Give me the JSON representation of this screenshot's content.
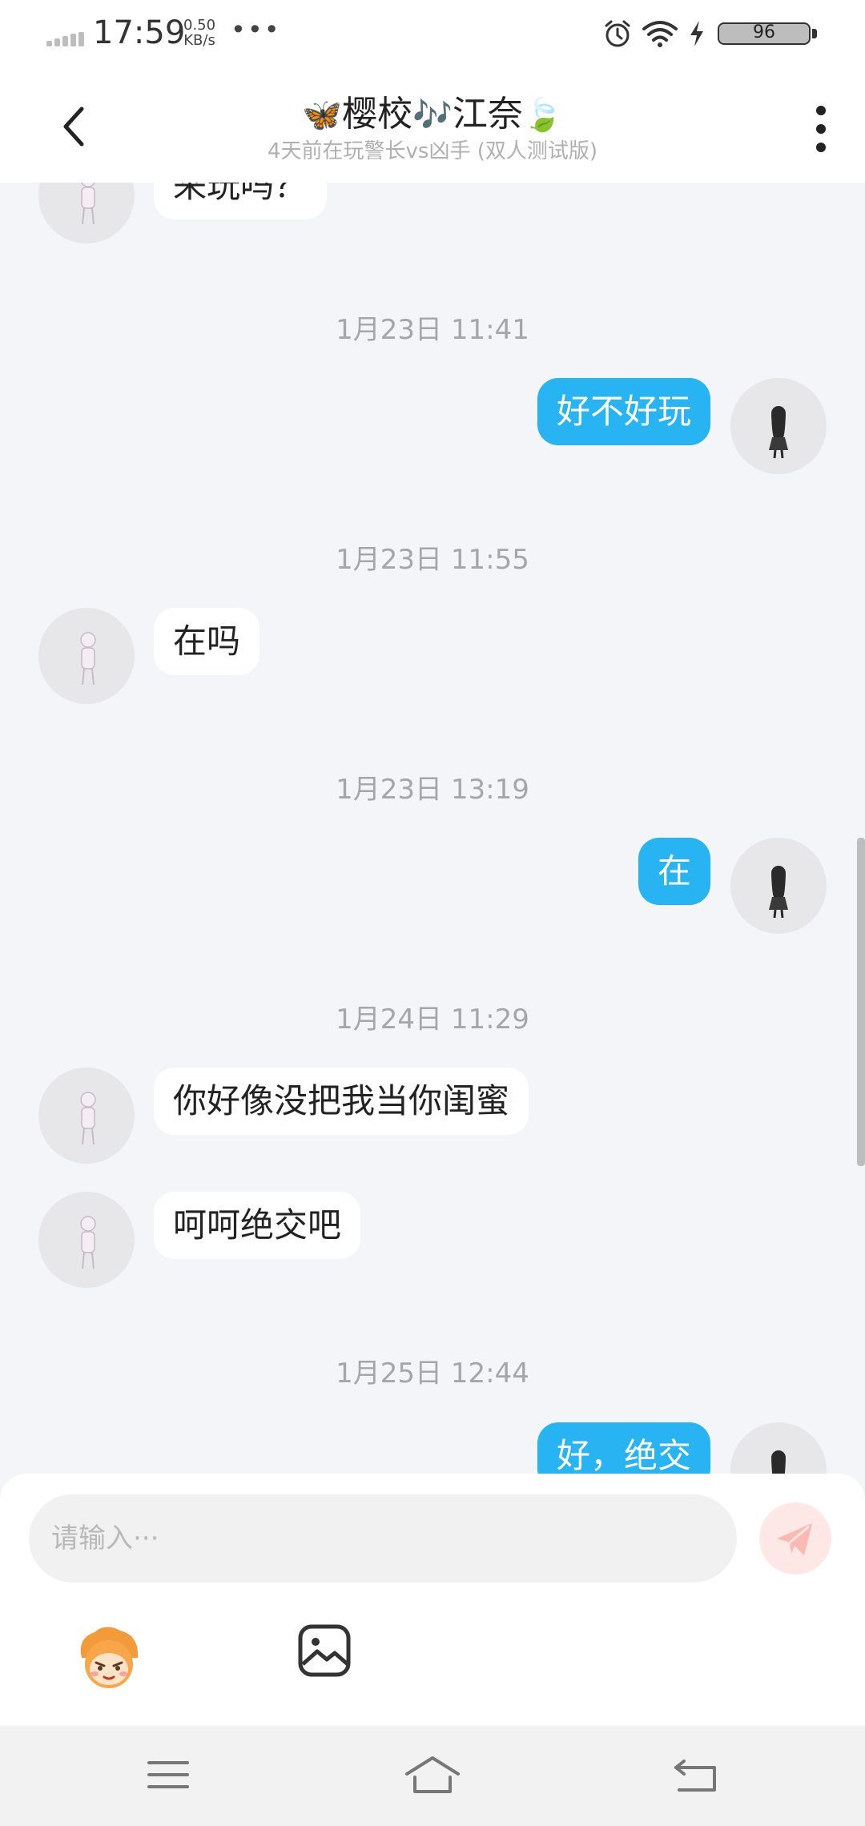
{
  "status_bar": {
    "time": "17:59",
    "speed_value": "0.50",
    "speed_unit": "KB/s",
    "dots": "•••",
    "battery": "96",
    "icons": [
      "signal-icon",
      "alarm-icon",
      "wifi-icon",
      "charging-icon",
      "battery-icon"
    ]
  },
  "header": {
    "title": "樱校",
    "title_suffix": "江奈",
    "emoji_left": "🦋",
    "emoji_mid": "🎶",
    "emoji_right": "🍃",
    "subtitle": "4天前在玩警长vs凶手 (双人测试版)",
    "icons": [
      "back-icon",
      "more-icon"
    ]
  },
  "messages": [
    {
      "type": "in",
      "text": "来玩吗？"
    },
    {
      "type": "time",
      "text": "1月23日 11:41"
    },
    {
      "type": "out",
      "text": "好不好玩"
    },
    {
      "type": "time",
      "text": "1月23日 11:55"
    },
    {
      "type": "in",
      "text": "在吗"
    },
    {
      "type": "time",
      "text": "1月23日 13:19"
    },
    {
      "type": "out",
      "text": "在"
    },
    {
      "type": "time",
      "text": "1月24日 11:29"
    },
    {
      "type": "in",
      "text": "你好像没把我当你闺蜜"
    },
    {
      "type": "in",
      "text": "呵呵绝交吧"
    },
    {
      "type": "time",
      "text": "1月25日 12:44"
    },
    {
      "type": "out",
      "text": "好，绝交"
    }
  ],
  "input": {
    "placeholder": "请输入···",
    "value": ""
  },
  "toolbar": {
    "icons": [
      "send-icon",
      "emoji-icon",
      "image-icon"
    ]
  },
  "nav": {
    "icons": [
      "menu-icon",
      "home-icon",
      "back-nav-icon"
    ]
  },
  "colors": {
    "outgoing_bubble": "#28b4f2",
    "incoming_bubble": "#ffffff",
    "chat_background": "#f3f5f8",
    "send_button": "#fde8e6"
  }
}
